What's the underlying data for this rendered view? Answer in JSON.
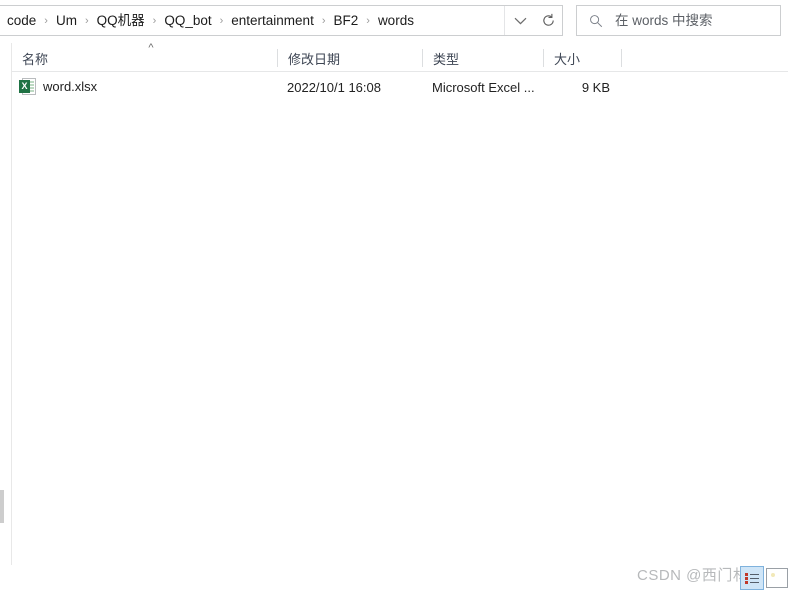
{
  "address_bar": {
    "breadcrumb_items": [
      "code",
      "Um",
      "QQ机器",
      "QQ_bot",
      "entertainment",
      "BF2",
      "words"
    ],
    "separator": "›",
    "dropdown_icon": "chevron-down-icon",
    "refresh_icon": "refresh-icon"
  },
  "search": {
    "placeholder": "在 words 中搜索",
    "value": "",
    "icon": "search-icon"
  },
  "columns": {
    "name": "名称",
    "date_modified": "修改日期",
    "type": "类型",
    "size": "大小",
    "sort_indicator": "^"
  },
  "files": [
    {
      "icon": "excel-file-icon",
      "icon_letter": "X",
      "name": "word.xlsx",
      "date_modified": "2022/10/1 16:08",
      "type": "Microsoft Excel ...",
      "size": "9 KB"
    }
  ],
  "watermark": {
    "text": "CSDN @西门林一"
  },
  "view_buttons": {
    "details_label": "details-view",
    "thumbnails_label": "large-icons-view"
  },
  "colors": {
    "border": "#ccced0",
    "header_text": "#3e4654",
    "excel_green": "#1f7244",
    "watermark": "#b7b9bb",
    "selection_blue": "#cfe5f7"
  }
}
